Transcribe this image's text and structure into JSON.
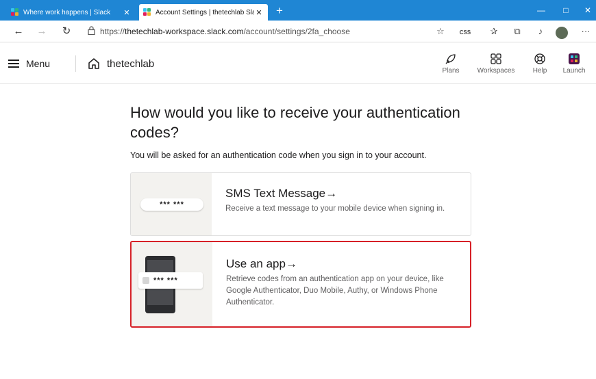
{
  "browser": {
    "tabs": [
      {
        "title": "Where work happens | Slack",
        "active": false
      },
      {
        "title": "Account Settings | thetechlab Sla",
        "active": true
      }
    ],
    "url": {
      "scheme": "https://",
      "host": "thetechlab-workspace.slack.com",
      "path": "/account/settings/2fa_choose"
    },
    "toolbar": {
      "css_badge": "CSS",
      "more": "···"
    },
    "window_controls": {
      "minimize": "—",
      "maximize": "□",
      "close": "✕"
    }
  },
  "header": {
    "menu_label": "Menu",
    "workspace_name": "thetechlab",
    "nav": [
      {
        "label": "Plans",
        "icon": "rocket-icon"
      },
      {
        "label": "Workspaces",
        "icon": "grid-icon"
      },
      {
        "label": "Help",
        "icon": "lifebuoy-icon"
      },
      {
        "label": "Launch",
        "icon": "slack-app-icon"
      }
    ]
  },
  "main": {
    "title": "How would you like to receive your authentication codes?",
    "subtitle": "You will be asked for an authentication code when you sign in to your account.",
    "options": [
      {
        "title": "SMS Text Message→",
        "description": "Receive a text message to your mobile device when signing in.",
        "code_sample": "*** ***",
        "selected": false
      },
      {
        "title": "Use an app→",
        "description": "Retrieve codes from an authentication app on your device, like Google Authenticator, Duo Mobile, Authy, or Windows Phone Authenticator.",
        "code_sample": "*** ***",
        "selected": true
      }
    ]
  },
  "colors": {
    "tabbar": "#1f86d4",
    "highlight_border": "#d62027",
    "text_primary": "#1d1c1d",
    "text_secondary": "#616061"
  }
}
